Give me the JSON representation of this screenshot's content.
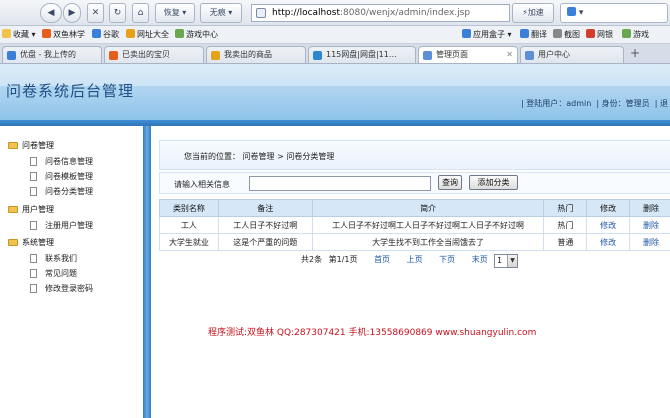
{
  "browser": {
    "nav": {
      "back": "◀",
      "forward": "▶",
      "stop": "✕",
      "refresh": "↻",
      "home": "⌂",
      "recover": "恢复",
      "unmark": "无痕",
      "speedup": "加速"
    },
    "address": {
      "host": "http://localhost",
      "path": ":8080/wenjx/admin/index.jsp"
    },
    "favorites": [
      {
        "label": "收藏",
        "color": "#f3c24a"
      },
      {
        "label": "双鱼林学",
        "color": "#e55e1a"
      },
      {
        "label": "谷歌",
        "color": "#3a7fd8"
      },
      {
        "label": "网址大全",
        "color": "#e7a21b"
      },
      {
        "label": "游戏中心",
        "color": "#6aa84f"
      },
      {
        "label": "应用盒子",
        "color": "#3a7fd8"
      },
      {
        "label": "翻译",
        "color": "#3a7fd8"
      },
      {
        "label": "截图",
        "color": "#888888"
      },
      {
        "label": "网银",
        "color": "#d33d2e"
      },
      {
        "label": "游戏",
        "color": "#6aa84f"
      }
    ],
    "tabs": [
      {
        "label": "优盘 - 我上传的",
        "icon_color": "#3a7fd8"
      },
      {
        "label": "已卖出的宝贝",
        "icon_color": "#e55e1a"
      },
      {
        "label": "我卖出的商品",
        "icon_color": "#e7a21b"
      },
      {
        "label": "115网盘|网盘|11…",
        "icon_color": "#2e86d1"
      },
      {
        "label": "管理页面",
        "icon_color": "#5b8fd6"
      },
      {
        "label": "用户中心",
        "icon_color": "#5b8fd6"
      }
    ]
  },
  "header": {
    "title": "问卷系统后台管理",
    "user_label": "| 登陆用户：",
    "user_name": "admin",
    "role_label": "| 身份：",
    "role_name": "管理员",
    "tail": "| 退"
  },
  "sidebar": {
    "groups": [
      {
        "label": "问卷管理",
        "items": [
          "问卷信息管理",
          "问卷模板管理",
          "问卷分类管理"
        ]
      },
      {
        "label": "用户管理",
        "items": [
          "注册用户管理"
        ]
      },
      {
        "label": "系统管理",
        "items": [
          "联系我们",
          "常见问题",
          "修改登录密码"
        ]
      }
    ]
  },
  "main": {
    "breadcrumb": "您当前的位置：  问卷管理 > 问卷分类管理",
    "search": {
      "label": "请输入相关信息",
      "value": "",
      "query_button": "查询",
      "add_button": "添加分类"
    },
    "table": {
      "headers": [
        "类别名称",
        "备注",
        "简介",
        "热门",
        "修改",
        "删除"
      ],
      "rows": [
        [
          "工人",
          "工人日子不好过啊",
          "工人日子不好过啊工人日子不好过啊工人日子不好过啊",
          "热门",
          "修改",
          "删除"
        ],
        [
          "大学生就业",
          "这是个严重的问题",
          "大学生找不到工作全当闹饿去了",
          "普通",
          "修改",
          "删除"
        ]
      ]
    },
    "pager": {
      "total": "共2条",
      "page": "第1/1页",
      "first": "首页",
      "prev": "上页",
      "next": "下页",
      "last": "末页",
      "selected": "1"
    },
    "credit": "程序测试:双鱼林 QQ:287307421 手机:13558690869 www.shuangyulin.com"
  }
}
